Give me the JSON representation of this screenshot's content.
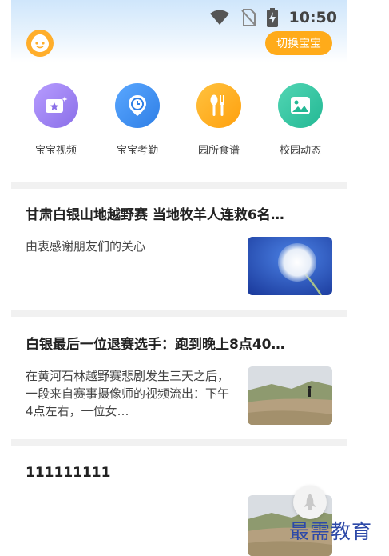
{
  "status_bar": {
    "time": "10:50"
  },
  "header": {
    "switch_button_label": "切换宝宝"
  },
  "quick_actions": [
    {
      "label": "宝宝视频",
      "icon": "video-star-icon",
      "color": "#9a7ff0"
    },
    {
      "label": "宝宝考勤",
      "icon": "clock-pin-icon",
      "color": "#3f8ff0"
    },
    {
      "label": "园所食谱",
      "icon": "utensils-icon",
      "color": "#ffad1a"
    },
    {
      "label": "校园动态",
      "icon": "image-icon",
      "color": "#2fc4a2"
    }
  ],
  "news": [
    {
      "title": "甘肃白银山地越野赛 当地牧羊人连救6名…",
      "summary": "由衷感谢朋友们的关心",
      "thumb": "dandelion-photo"
    },
    {
      "title": "白银最后一位退赛选手：跑到晚上8点40…",
      "summary": "在黄河石林越野赛悲剧发生三天之后，一段来自赛事摄像师的视频流出：下午4点左右，一位女…",
      "thumb": "mountain-runner-photo"
    },
    {
      "title": "111111111",
      "summary": "",
      "thumb": "mountain-photo"
    }
  ],
  "watermark": "最需教育",
  "colors": {
    "accent": "#ffab1a",
    "divider": "#f1f1f1",
    "watermark": "#2d49a8"
  }
}
